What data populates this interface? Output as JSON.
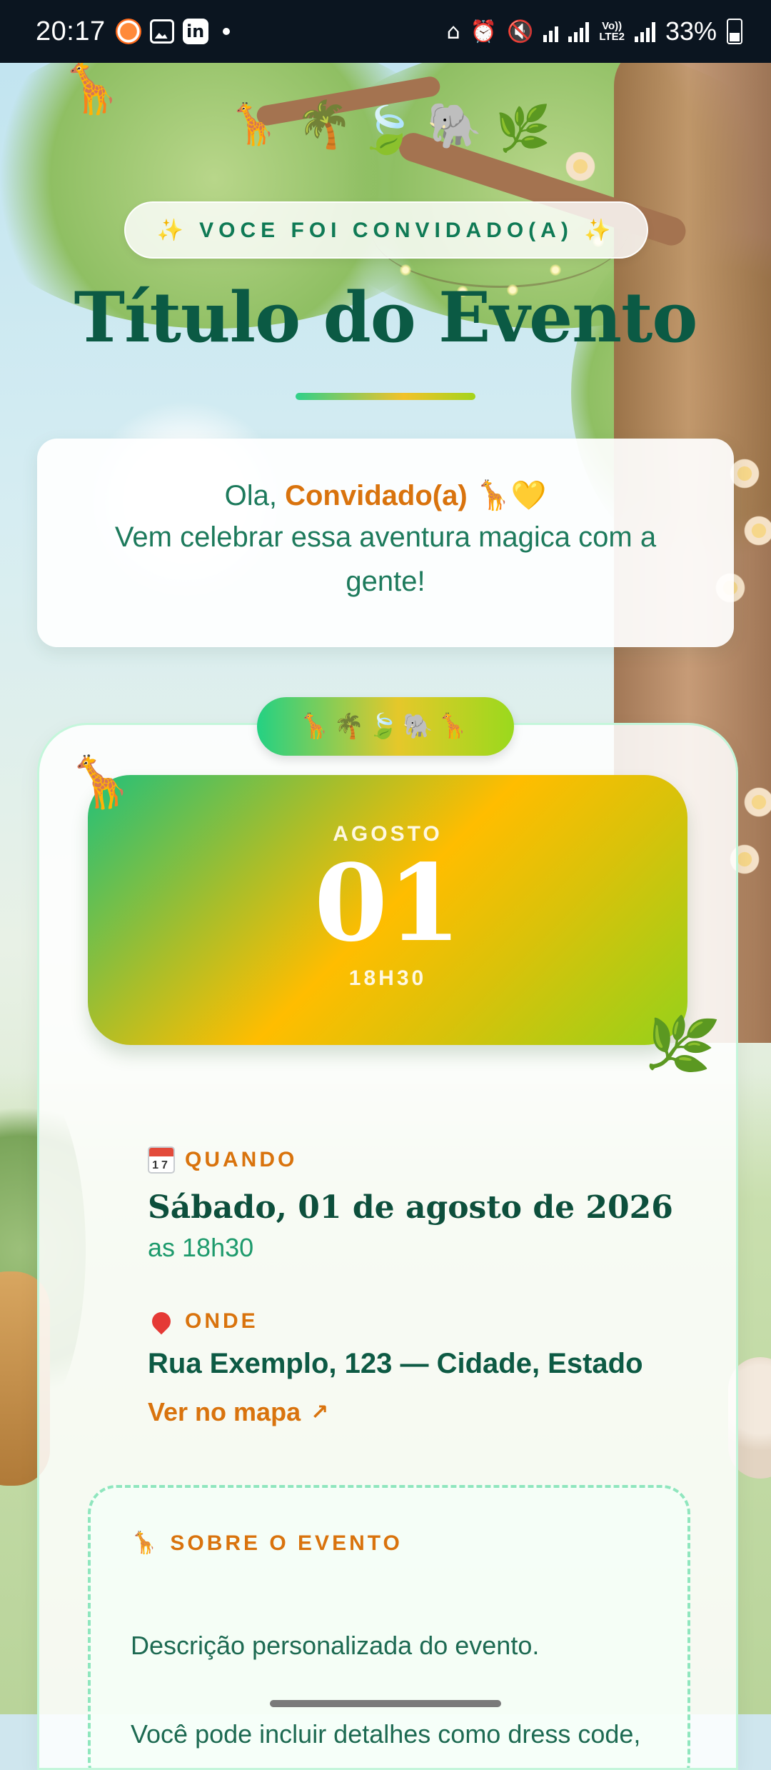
{
  "status_bar": {
    "time": "20:17",
    "battery": "33%"
  },
  "invite": {
    "label": "✨ VOCE FOI CONVIDADO(A) ✨"
  },
  "event": {
    "title": "Título do Evento"
  },
  "greeting": {
    "prefix": "Ola,",
    "name": "Convidado(a)",
    "emoji": "🦒💛",
    "message": "Vem celebrar essa aventura magica com a gente!"
  },
  "decor": {
    "emoji_strip": "🦒🌴🍃🐘🦒",
    "corner_emoji": "🦒",
    "leaf_emoji": "🌿",
    "top_emojis": [
      "🦒",
      "🦒",
      "🌴",
      "🍃",
      "🐘",
      "🌿"
    ]
  },
  "date_card": {
    "month": "AGOSTO",
    "day": "01",
    "time": "18H30"
  },
  "when": {
    "label": "QUANDO",
    "date": "Sábado, 01 de agosto de 2026",
    "time": "as 18h30"
  },
  "where": {
    "label": "ONDE",
    "address": "Rua Exemplo, 123 — Cidade, Estado",
    "map_link": "Ver no mapa"
  },
  "about": {
    "label": "SOBRE O EVENTO",
    "paragraph1": "Descrição personalizada do evento.",
    "paragraph2": "Você pode incluir detalhes como dress code, instruções especiais, e muito mais."
  },
  "colors": {
    "accent_green": "#0b5a44",
    "accent_orange": "#d9730d",
    "status_bar": "#0b1520"
  }
}
